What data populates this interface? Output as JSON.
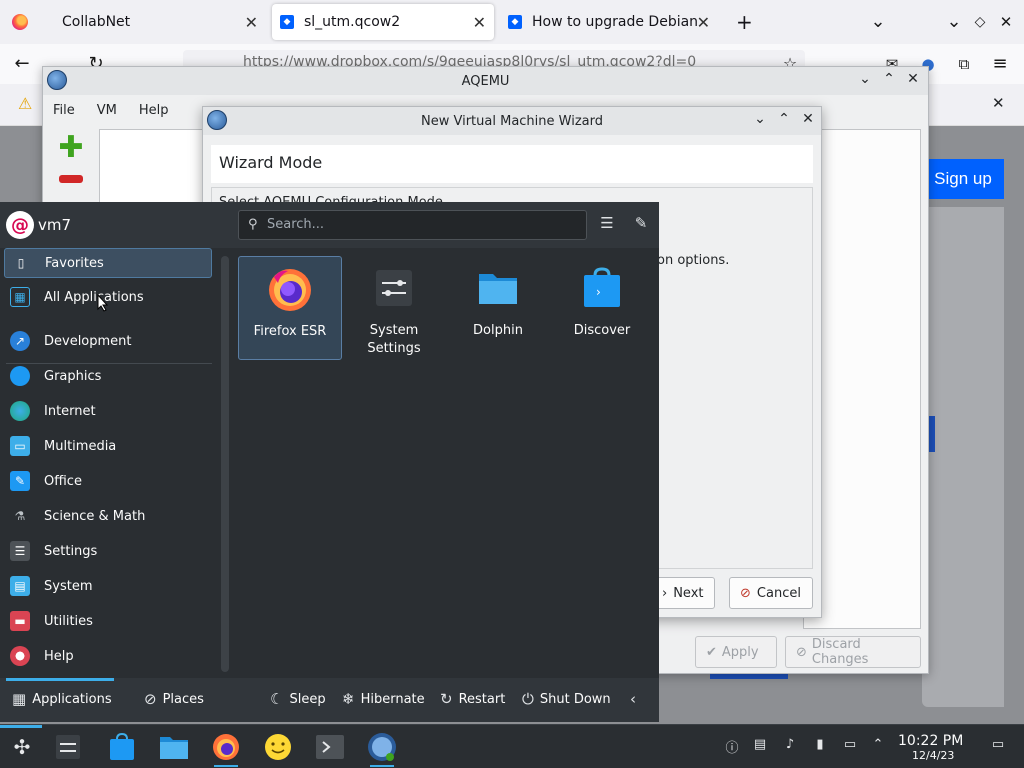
{
  "firefox": {
    "tabs": [
      {
        "label": "CollabNet",
        "icon": "firefox-icon"
      },
      {
        "label": "sl_utm.qcow2",
        "icon": "dropbox-icon"
      },
      {
        "label": "How to upgrade Debian dr",
        "icon": "dropbox-icon"
      }
    ],
    "new_tab": "+",
    "url": "https://www.dropbox.com/s/9geeujasp8l0rys/sl_utm.qcow2?dl=0",
    "signup_label": "Sign up"
  },
  "aqemu": {
    "title": "AQEMU",
    "menu": [
      "File",
      "VM",
      "Help"
    ],
    "apply_label": "Apply",
    "discard_label": "Discard Changes"
  },
  "wizard": {
    "title": "New Virtual Machine Wizard",
    "header": "Wizard Mode",
    "subtitle": "Select AQEMU Configuration Mode",
    "options_text": "on options.",
    "next_label": "Next",
    "cancel_label": "Cancel"
  },
  "launcher": {
    "user": "vm7",
    "search_placeholder": "Search...",
    "categories": [
      {
        "label": "Favorites",
        "icon": "bookmark-icon",
        "color": "#31363b"
      },
      {
        "label": "All Applications",
        "icon": "grid-icon",
        "color": "#3daee9"
      },
      {
        "label": "Development",
        "icon": "development-icon",
        "color": "#2980d9"
      },
      {
        "label": "Graphics",
        "icon": "graphics-icon",
        "color": "#1d99f3"
      },
      {
        "label": "Internet",
        "icon": "internet-icon",
        "color": "#1ea97c"
      },
      {
        "label": "Multimedia",
        "icon": "multimedia-icon",
        "color": "#3daee9"
      },
      {
        "label": "Office",
        "icon": "office-icon",
        "color": "#1d99f3"
      },
      {
        "label": "Science & Math",
        "icon": "science-icon",
        "color": "#7f8c8d"
      },
      {
        "label": "Settings",
        "icon": "settings-icon",
        "color": "#4d5257"
      },
      {
        "label": "System",
        "icon": "system-icon",
        "color": "#3daee9"
      },
      {
        "label": "Utilities",
        "icon": "utilities-icon",
        "color": "#da4453"
      },
      {
        "label": "Help",
        "icon": "help-icon",
        "color": "#da4453"
      }
    ],
    "apps": [
      {
        "label": "Firefox ESR",
        "icon": "firefox-icon"
      },
      {
        "label": "System Settings",
        "icon": "system-settings-icon"
      },
      {
        "label": "Dolphin",
        "icon": "folder-icon"
      },
      {
        "label": "Discover",
        "icon": "discover-icon"
      }
    ],
    "footer": {
      "applications": "Applications",
      "places": "Places",
      "sleep": "Sleep",
      "hibernate": "Hibernate",
      "restart": "Restart",
      "shutdown": "Shut Down"
    }
  },
  "taskbar": {
    "time": "10:22 PM",
    "date": "12/4/23"
  },
  "colors": {
    "accent": "#3daee9",
    "launcher_bg": "#2a2e32",
    "dropbox_blue": "#0061fe"
  }
}
